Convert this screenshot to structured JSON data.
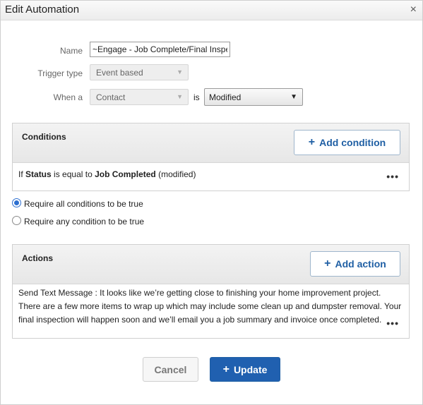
{
  "dialog": {
    "title": "Edit Automation",
    "close_icon": "×"
  },
  "form": {
    "name_label": "Name",
    "name_value": "~Engage - Job Complete/Final Inspection",
    "trigger_label": "Trigger type",
    "trigger_value": "Event based",
    "when_label": "When a",
    "when_value": "Contact",
    "is_label": "is",
    "event_value": "Modified",
    "dropdown_icon": "▼"
  },
  "conditions": {
    "title": "Conditions",
    "add_label": "Add condition",
    "plus_icon": "+",
    "items": [
      {
        "prefix": "If",
        "field": "Status",
        "operator": "is equal to",
        "value": "Job Completed",
        "suffix": "(modified)",
        "more_icon": "•••"
      }
    ]
  },
  "match": {
    "options": [
      {
        "label": "Require all conditions to be true",
        "selected": true
      },
      {
        "label": "Require any condition to be true",
        "selected": false
      }
    ]
  },
  "actions": {
    "title": "Actions",
    "add_label": "Add action",
    "plus_icon": "+",
    "items": [
      {
        "lines": [
          "Send Text Message : It looks like we’re getting close to finishing your home improvement project.",
          "There are a few more items to wrap up which may include some clean up and dumpster removal. Your",
          "final inspection will happen soon and we’ll email you a job summary and invoice once completed."
        ],
        "more_icon": "•••"
      }
    ]
  },
  "footer": {
    "cancel_label": "Cancel",
    "update_label": "Update",
    "plus_icon": "+"
  },
  "colors": {
    "accent": "#2060b0",
    "accent_text": "#1f5fa4",
    "radio": "#2d6fd0"
  }
}
